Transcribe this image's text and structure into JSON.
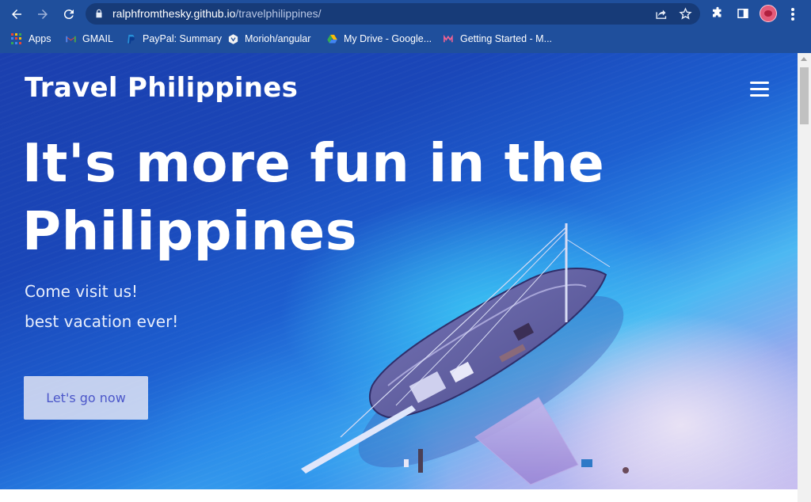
{
  "browser": {
    "url_host": "ralphfromthesky.github.io",
    "url_path": "/travelphilippines/",
    "bookmarks": [
      {
        "label": "Apps",
        "icon": "apps-grid-icon"
      },
      {
        "label": "GMAIL",
        "icon": "gmail-icon"
      },
      {
        "label": "PayPal: Summary",
        "icon": "paypal-icon"
      },
      {
        "label": "Morioh/angular",
        "icon": "morioh-icon"
      },
      {
        "label": "My Drive - Google...",
        "icon": "google-drive-icon"
      },
      {
        "label": "Getting Started - M...",
        "icon": "mean-icon"
      }
    ]
  },
  "site": {
    "brand": "Travel Philippines",
    "menu_icon": "hamburger-menu-icon"
  },
  "hero": {
    "headline_line1": "It's more fun in the",
    "headline_line2": "Philippines",
    "subtitle_1": "Come visit us!",
    "subtitle_2": "best vacation ever!",
    "cta_label": "Let's go now"
  },
  "colors": {
    "chrome": "#1f4f9c",
    "omnibox": "#173b78",
    "cta_text": "#4b56c9",
    "ocean_deep": "#1b3fae",
    "ocean_shallow": "#4cb8f2",
    "sand": "#c7bdf0"
  }
}
